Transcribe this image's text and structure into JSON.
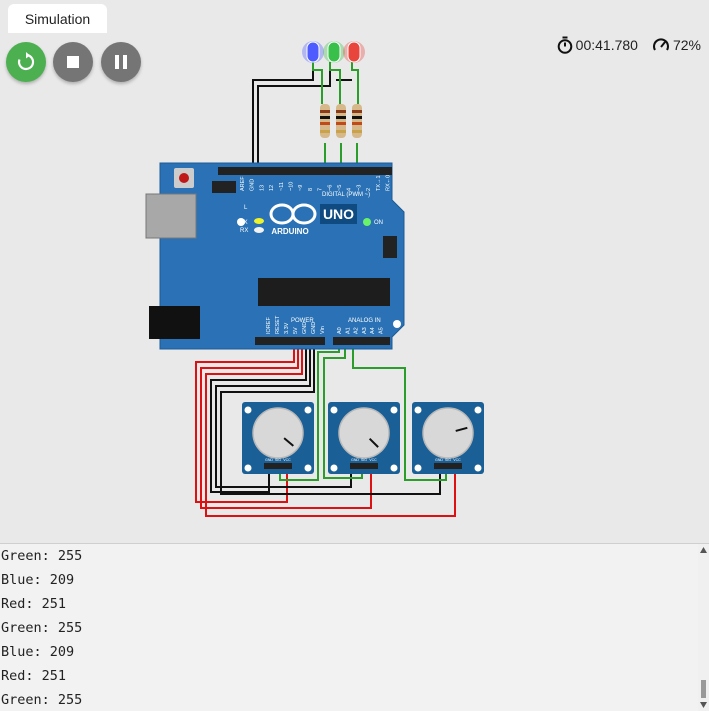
{
  "tab": {
    "label": "Simulation"
  },
  "controls": {
    "restart_icon": "restart-icon",
    "stop_icon": "stop-icon",
    "pause_icon": "pause-icon",
    "restart_color": "#4caf50",
    "stop_color": "#757575",
    "pause_color": "#757575"
  },
  "stats": {
    "time": "00:41.780",
    "speed": "72%",
    "timer_icon": "stopwatch-icon",
    "speed_icon": "gauge-icon"
  },
  "board": {
    "name": "UNO",
    "brand": "ARDUINO",
    "on_label": "ON",
    "l_label": "L",
    "tx_label": "TX",
    "rx_label": "RX",
    "digital_label": "DIGITAL (PWM ~)",
    "analog_label": "ANALOG IN",
    "power_label": "POWER",
    "digital_pins": [
      "AREF",
      "GND",
      "13",
      "12",
      "~11",
      "~10",
      "~9",
      "8",
      "7",
      "~6",
      "~5",
      "4",
      "~3",
      "2",
      "TX→1",
      "RX←0"
    ],
    "power_pins": [
      "IOREF",
      "RESET",
      "3.3V",
      "5V",
      "GND",
      "GND",
      "Vin"
    ],
    "analog_pins": [
      "A0",
      "A1",
      "A2",
      "A3",
      "A4",
      "A5"
    ]
  },
  "leds": [
    {
      "name": "blue-led",
      "color": "#4d5bff"
    },
    {
      "name": "green-led",
      "color": "#39c04a"
    },
    {
      "name": "red-led",
      "color": "#e8453c"
    }
  ],
  "potentiometers": [
    {
      "name": "potentiometer-1",
      "pin_labels": [
        "GND",
        "SIG",
        "VCC"
      ]
    },
    {
      "name": "potentiometer-2",
      "pin_labels": [
        "GND",
        "SIG",
        "VCC"
      ]
    },
    {
      "name": "potentiometer-3",
      "pin_labels": [
        "GND",
        "SIG",
        "VCC"
      ]
    }
  ],
  "console": {
    "lines": [
      "Green: 255",
      "Blue: 209",
      "Red: 251",
      "Green: 255",
      "Blue: 209",
      "Red: 251",
      "Green: 255"
    ]
  }
}
